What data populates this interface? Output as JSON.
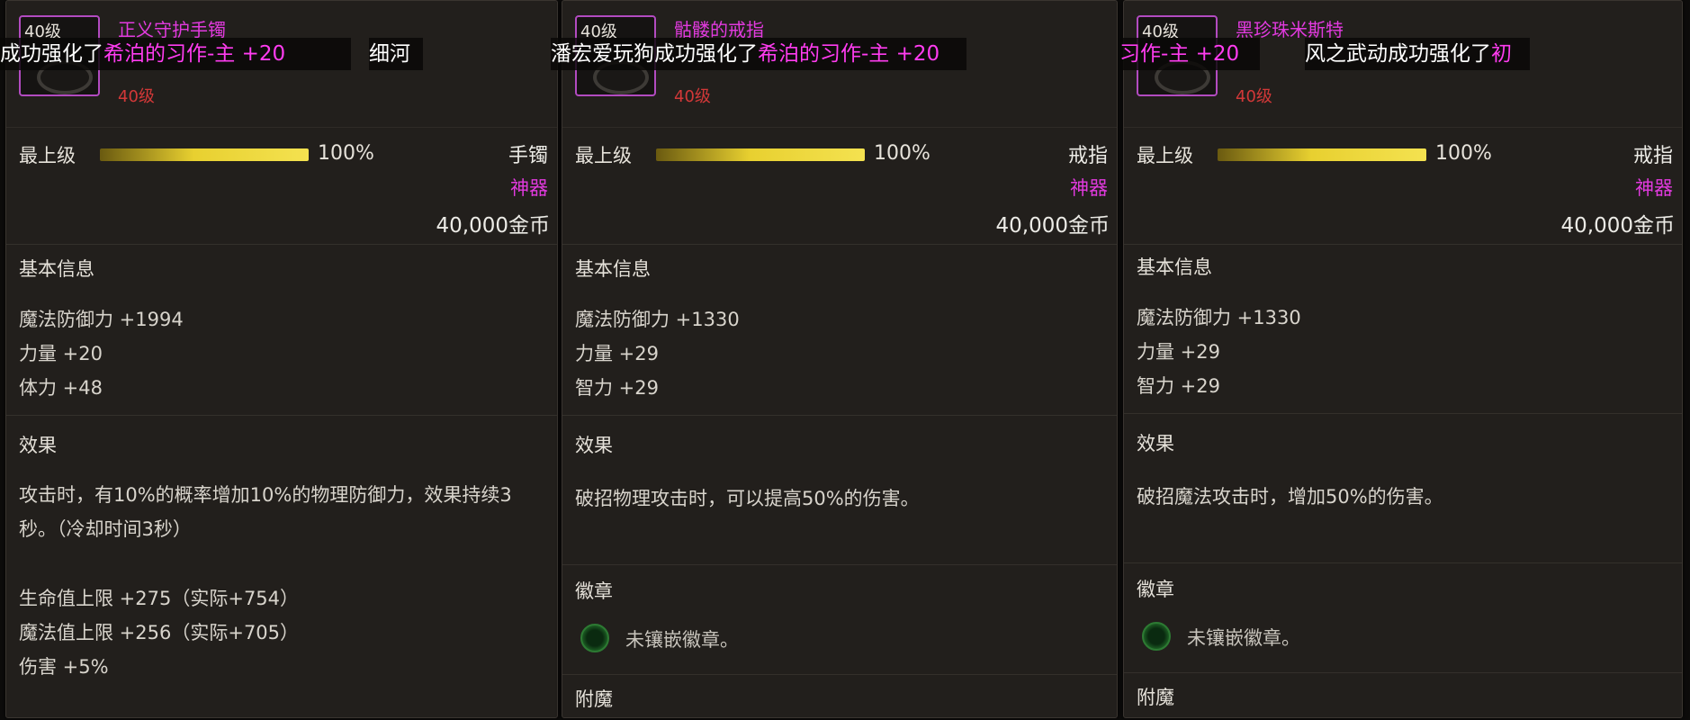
{
  "panels": [
    {
      "icon_level": "40级",
      "name": "正义守护手镯",
      "sub": "",
      "level": "40级",
      "grade_label": "最上级",
      "grade_pct": "100%",
      "grade_fraction": 1.0,
      "slot_type": "手镯",
      "rarity": "神器",
      "price": "40,000金币",
      "basic_title": "基本信息",
      "stats": [
        "魔法防御力 +1994",
        "力量 +20",
        "体力 +48"
      ],
      "effect_title": "效果",
      "effect_text": "攻击时，有10%的概率增加10%的物理防御力，效果持续3秒。（冷却时间3秒）",
      "extra_stats": [
        "生命值上限 +275（实际+754）",
        "魔法值上限 +256（实际+705）",
        "伤害 +5%"
      ]
    },
    {
      "icon_level": "40级",
      "name": "骷髅的戒指",
      "sub": "",
      "level": "40级",
      "grade_label": "最上级",
      "grade_pct": "100%",
      "grade_fraction": 1.0,
      "slot_type": "戒指",
      "rarity": "神器",
      "price": "40,000金币",
      "basic_title": "基本信息",
      "stats": [
        "魔法防御力 +1330",
        "力量 +29",
        "智力 +29"
      ],
      "effect_title": "效果",
      "effect_text": "破招物理攻击时，可以提高50%的伤害。",
      "emblem_title": "徽章",
      "emblem_text": "未镶嵌徽章。",
      "enchant_title": "附魔"
    },
    {
      "icon_level": "40级",
      "name": "黑珍珠米斯特",
      "sub": "",
      "level": "40级",
      "grade_label": "最上级",
      "grade_pct": "100%",
      "grade_fraction": 1.0,
      "slot_type": "戒指",
      "rarity": "神器",
      "price": "40,000金币",
      "basic_title": "基本信息",
      "stats": [
        "魔法防御力 +1330",
        "力量 +29",
        "智力 +29"
      ],
      "effect_title": "效果",
      "effect_text": "破招魔法攻击时，增加50%的伤害。",
      "emblem_title": "徽章",
      "emblem_text": "未镶嵌徽章。",
      "enchant_title": "附魔"
    }
  ],
  "tickers": {
    "t0_white": "成功强化了",
    "t0_pink": "希泊的习作-主 +20",
    "t0b_white": "细河",
    "t1_white": "潘宏爱玩狗成功强化了",
    "t1_pink": "希泊的习作-主 +20",
    "t2_pink": "习作-主 +20",
    "t2b_white": "风之武动成功强化了",
    "t2b_pink": "初"
  },
  "colors": {
    "rarity": "#e23adf",
    "level": "#d23838",
    "grade_bar": "#e8d030",
    "emblem": "#2d7a33"
  }
}
